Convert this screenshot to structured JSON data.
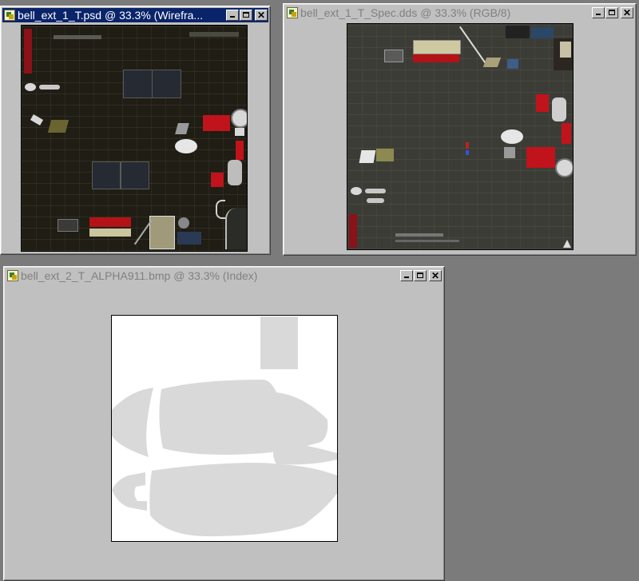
{
  "windows": [
    {
      "id": "psd",
      "title": "bell_ext_1_T.psd @ 33.3% (Wirefra...",
      "active": true
    },
    {
      "id": "spec",
      "title": "bell_ext_1_T_Spec.dds @ 33.3% (RGB/8)",
      "active": false
    },
    {
      "id": "alpha",
      "title": "bell_ext_2_T_ALPHA911.bmp @ 33.3% (Index)",
      "active": false
    }
  ],
  "window_buttons": {
    "minimize_glyph": "",
    "maximize_glyph": "",
    "close_glyph": "✕"
  },
  "icons": [
    "photoshop-document-icon",
    "minimize-icon",
    "maximize-icon",
    "close-icon"
  ],
  "colors": {
    "desktop": "#7b7b7b",
    "active_title": "#0a246a",
    "inactive_title_text": "#808080",
    "texture_dark": "#1f1d14",
    "spec_bg": "#3c3c37",
    "alpha_shape": "#d9d9d9",
    "red_part": "#c0131b"
  }
}
